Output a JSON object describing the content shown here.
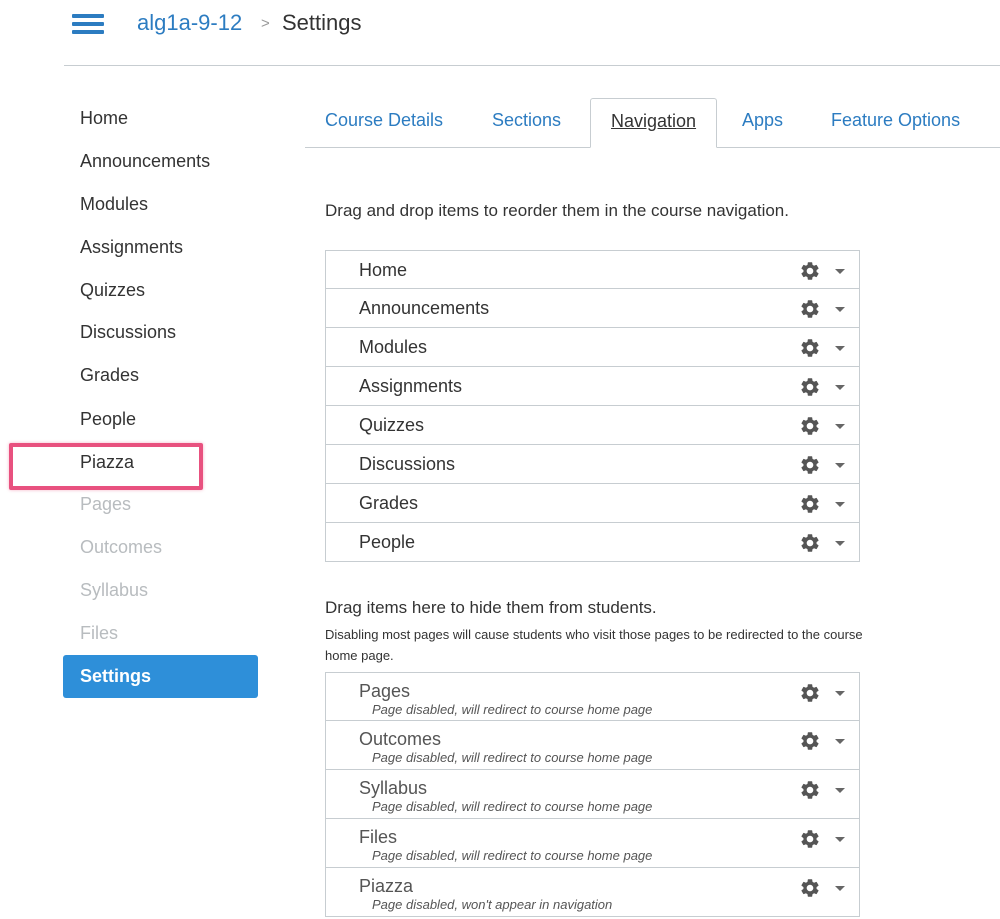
{
  "header": {
    "breadcrumb_course": "alg1a-9-12",
    "breadcrumb_separator": ">",
    "breadcrumb_page": "Settings",
    "accent_color": "#2c7cc1"
  },
  "sidebar": {
    "items": [
      {
        "label": "Home",
        "state": "enabled"
      },
      {
        "label": "Announcements",
        "state": "enabled"
      },
      {
        "label": "Modules",
        "state": "enabled"
      },
      {
        "label": "Assignments",
        "state": "enabled"
      },
      {
        "label": "Quizzes",
        "state": "enabled"
      },
      {
        "label": "Discussions",
        "state": "enabled"
      },
      {
        "label": "Grades",
        "state": "enabled"
      },
      {
        "label": "People",
        "state": "enabled"
      },
      {
        "label": "Piazza",
        "state": "highlighted"
      },
      {
        "label": "Pages",
        "state": "disabled"
      },
      {
        "label": "Outcomes",
        "state": "disabled"
      },
      {
        "label": "Syllabus",
        "state": "disabled"
      },
      {
        "label": "Files",
        "state": "disabled"
      }
    ],
    "active_label": "Settings",
    "active_color": "#2e8fd9",
    "highlight_color": "#e8517f"
  },
  "tabs": [
    {
      "label": "Course Details",
      "active": false
    },
    {
      "label": "Sections",
      "active": false
    },
    {
      "label": "Navigation",
      "active": true
    },
    {
      "label": "Apps",
      "active": false
    },
    {
      "label": "Feature Options",
      "active": false
    }
  ],
  "navigation": {
    "instructions": "Drag and drop items to reorder them in the course navigation.",
    "enabled_items": [
      "Home",
      "Announcements",
      "Modules",
      "Assignments",
      "Quizzes",
      "Discussions",
      "Grades",
      "People"
    ],
    "hidden_title": "Drag items here to hide them from students.",
    "hidden_description": "Disabling most pages will cause students who visit those pages to be redirected to the course home page.",
    "hidden_items": [
      {
        "label": "Pages",
        "note": "Page disabled, will redirect to course home page"
      },
      {
        "label": "Outcomes",
        "note": "Page disabled, will redirect to course home page"
      },
      {
        "label": "Syllabus",
        "note": "Page disabled, will redirect to course home page"
      },
      {
        "label": "Files",
        "note": "Page disabled, will redirect to course home page"
      },
      {
        "label": "Piazza",
        "note": "Page disabled, won't appear in navigation"
      }
    ],
    "row_icon": "gear-icon",
    "row_menu_icon": "caret-down-icon"
  }
}
